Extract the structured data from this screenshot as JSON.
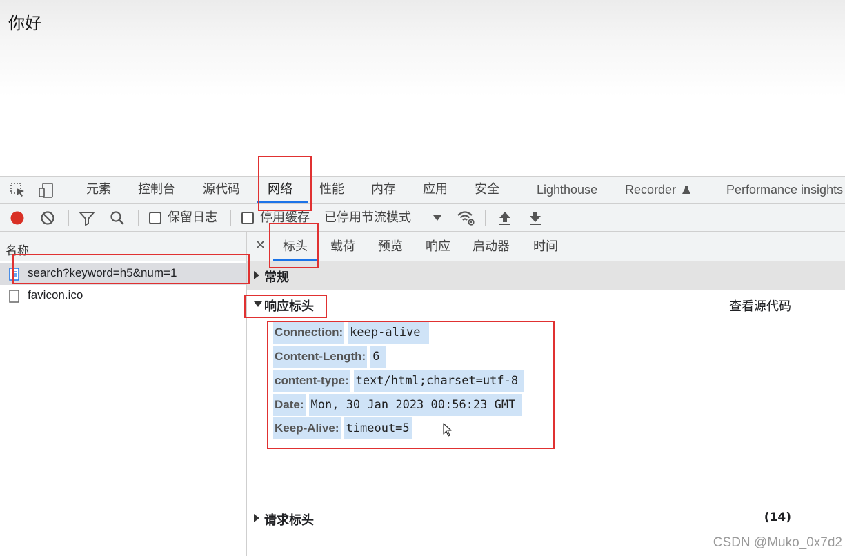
{
  "page": {
    "content_text": "你好"
  },
  "devtools": {
    "main_tabs": [
      {
        "label": "元素"
      },
      {
        "label": "控制台"
      },
      {
        "label": "源代码"
      },
      {
        "label": "网络"
      },
      {
        "label": "性能"
      },
      {
        "label": "内存"
      },
      {
        "label": "应用"
      },
      {
        "label": "安全"
      },
      {
        "label": "Lighthouse"
      },
      {
        "label": "Recorder"
      },
      {
        "label": "Performance insights"
      }
    ],
    "active_main_tab": "网络",
    "toolbar": {
      "preserve_log_label": "保留日志",
      "disable_cache_label": "停用缓存",
      "throttling_label": "已停用节流模式"
    },
    "request_list": {
      "column_header": "名称",
      "items": [
        {
          "name": "search?keyword=h5&num=1",
          "selected": true
        },
        {
          "name": "favicon.ico",
          "selected": false
        }
      ]
    },
    "detail_tabs": [
      {
        "label": "标头"
      },
      {
        "label": "载荷"
      },
      {
        "label": "预览"
      },
      {
        "label": "响应"
      },
      {
        "label": "启动器"
      },
      {
        "label": "时间"
      }
    ],
    "active_detail_tab": "标头",
    "sections": {
      "general_title": "常规",
      "response_headers_title": "响应标头",
      "view_source_label": "查看源代码",
      "request_headers_title": "请求标头",
      "request_headers_count": "(14)"
    },
    "response_headers": [
      {
        "name": "Connection:",
        "value": "keep-alive"
      },
      {
        "name": "Content-Length:",
        "value": "6"
      },
      {
        "name": "content-type:",
        "value": "text/html;charset=utf-8"
      },
      {
        "name": "Date:",
        "value": "Mon, 30 Jan 2023 00:56:23 GMT"
      },
      {
        "name": "Keep-Alive:",
        "value": "timeout=5"
      }
    ]
  },
  "watermark": "CSDN @Muko_0x7d2",
  "colors": {
    "record": "#d93025",
    "accent": "#1a73e8",
    "annotation": "#e03131",
    "highlight": "#cfe3f7"
  }
}
